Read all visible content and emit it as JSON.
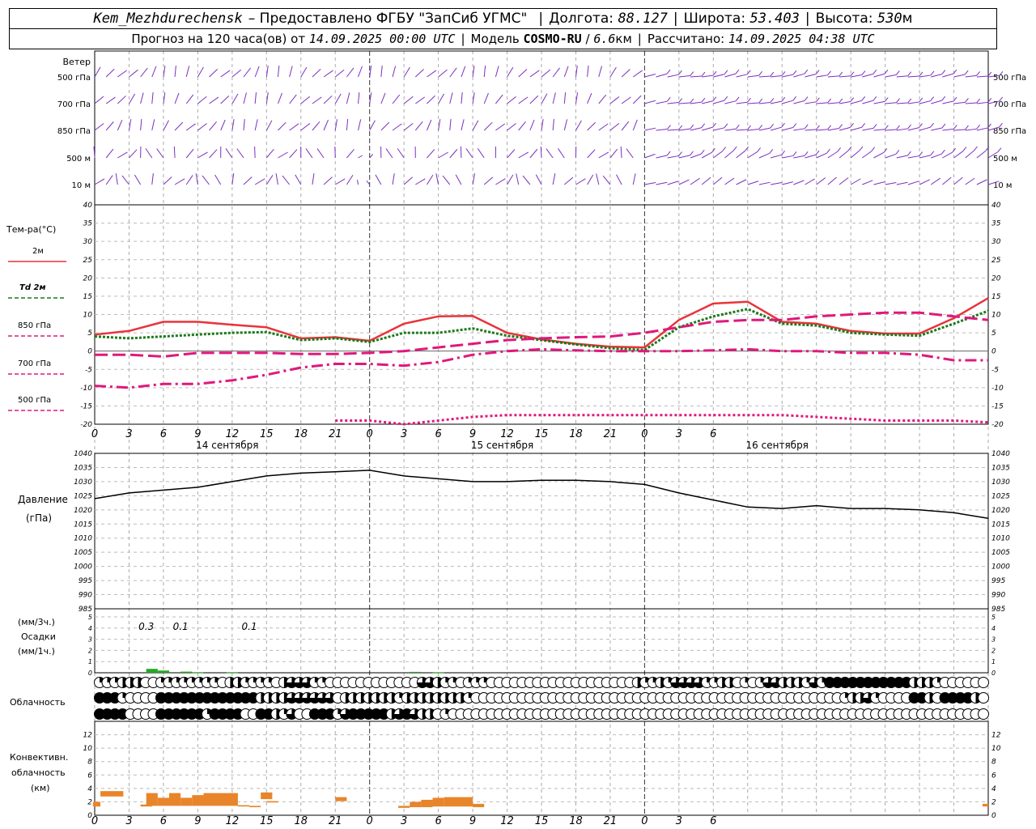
{
  "header": {
    "station": "Kem_Mezhdurechensk",
    "provided_by": "– Предоставлено ФГБУ \"ЗапСиб УГМС\"",
    "lon_label": "Долгота:",
    "lon_value": "88.127",
    "lat_label": "Широта:",
    "lat_value": "53.403",
    "alt_label": "Высота:",
    "alt_value": "530",
    "alt_unit": "м",
    "forecast_label": "Прогноз на 120 часа(ов)  от",
    "forecast_start": "14.09.2025 00:00 UTC",
    "model_label": "Модель",
    "model_name": "COSMO-RU",
    "model_res_value": "6.6",
    "model_res_unit": "км",
    "computed_label": "Рассчитано:",
    "computed_time": "14.09.2025 04:38 UTC"
  },
  "colors": {
    "t2m": "#e8343a",
    "td2m": "#1a7a1a",
    "t850": "#e0187c",
    "t700": "#e0187c",
    "t500": "#e0187c",
    "wind": "#7b2fbf",
    "pressure": "#000000",
    "precip": "#22aa22",
    "convective": "#e8852a",
    "grid": "#999999"
  },
  "chart_data": {
    "type": "line",
    "x_ticks": [
      "0",
      "3",
      "6",
      "9",
      "12",
      "15",
      "18",
      "21",
      "0",
      "3",
      "6",
      "9",
      "12",
      "15",
      "18",
      "21",
      "0",
      "3",
      "6"
    ],
    "day_labels": [
      {
        "label": "14 сентября"
      },
      {
        "label": "15 сентября"
      },
      {
        "label": "16 сентября"
      }
    ],
    "wind": {
      "label": "Ветер",
      "levels": [
        "500 гПа",
        "700 гПа",
        "850 гПа",
        "500 м",
        "10  м"
      ],
      "unit_left_prefix": "",
      "right_levels": [
        "500 гПа",
        "700 гПа",
        "850 гПа",
        "500 м",
        "10  м"
      ]
    },
    "temperature": {
      "ylabel": "Тем-ра(°С)",
      "ylim": [
        -20,
        40
      ],
      "y_ticks": [
        40,
        35,
        30,
        25,
        20,
        15,
        10,
        5,
        0,
        -5,
        -10,
        -15,
        -20
      ],
      "x_hours": [
        0,
        3,
        6,
        9,
        12,
        15,
        18,
        21,
        24,
        27,
        30,
        33,
        36,
        39,
        42,
        45,
        48,
        51,
        54,
        57,
        60,
        63,
        66,
        69,
        72,
        75,
        78
      ],
      "series": [
        {
          "name": "2м",
          "values": [
            4.5,
            5.5,
            8,
            8,
            7.2,
            6.5,
            3.5,
            3.8,
            2.8,
            7.5,
            9.5,
            9.6,
            5,
            3.2,
            2,
            1.2,
            1,
            8.5,
            13,
            13.5,
            8,
            7.5,
            5.5,
            4.8,
            4.8,
            9,
            14.5
          ]
        },
        {
          "name": "Td 2м",
          "values": [
            4,
            3.5,
            4,
            4.5,
            5,
            5.2,
            3,
            3.5,
            2.5,
            5,
            5,
            6.2,
            4.2,
            3,
            1.8,
            0.8,
            0.3,
            6.5,
            9.5,
            11.5,
            7.5,
            7,
            5,
            4.5,
            4.2,
            7.5,
            11
          ]
        },
        {
          "name": "850 гПа",
          "values": [
            -1,
            -1,
            -1.5,
            -0.5,
            -0.5,
            -0.5,
            -0.8,
            -0.8,
            -0.5,
            0,
            1,
            2,
            3,
            3.5,
            3.8,
            4,
            5,
            6.5,
            8,
            8.5,
            8.5,
            9.5,
            10,
            10.5,
            10.5,
            9.5,
            8.5
          ]
        },
        {
          "name": "700 гПа",
          "values": [
            -9.5,
            -10,
            -9,
            -9,
            -8,
            -6.5,
            -4.5,
            -3.5,
            -3.5,
            -4,
            -3,
            -1,
            0,
            0.5,
            0.2,
            0,
            0,
            0,
            0.2,
            0.5,
            0,
            0,
            -0.5,
            -0.5,
            -1,
            -2.5,
            -2.5
          ]
        },
        {
          "name": "500 гПа",
          "values": [
            null,
            null,
            null,
            null,
            null,
            null,
            null,
            -19,
            -19,
            -20,
            -19,
            -18,
            -17.5,
            -17.5,
            -17.5,
            -17.5,
            -17.5,
            -17.5,
            -17.5,
            -17.5,
            -17.5,
            -18,
            -18.5,
            -19,
            -19,
            -19,
            -19.5
          ]
        }
      ]
    },
    "pressure": {
      "ylabel": "Давление",
      "yunit": "(гПа)",
      "ylim": [
        985,
        1040
      ],
      "y_ticks": [
        1040,
        1035,
        1030,
        1025,
        1020,
        1015,
        1010,
        1005,
        1000,
        995,
        990,
        985
      ],
      "x_hours": [
        0,
        3,
        6,
        9,
        12,
        15,
        18,
        21,
        24,
        27,
        30,
        33,
        36,
        39,
        42,
        45,
        48,
        51,
        54,
        57,
        60,
        63,
        66,
        69,
        72,
        75,
        78
      ],
      "values": [
        1024,
        1026,
        1027,
        1028,
        1030,
        1032,
        1033,
        1033.5,
        1034,
        1032,
        1031,
        1030,
        1030,
        1030.5,
        1030.5,
        1030,
        1029,
        1026,
        1023.5,
        1021,
        1020.5,
        1021.5,
        1020.5,
        1020.5,
        1020,
        1019,
        1017
      ]
    },
    "precipitation": {
      "ylabel_top": "(мм/3ч.)",
      "ylabel_mid": "Осадки",
      "ylabel_bottom": "(мм/1ч.)",
      "ylim": [
        0,
        5
      ],
      "y_ticks": [
        5,
        4,
        3,
        2,
        1,
        0
      ],
      "amounts_3h": [
        {
          "hour": 4.5,
          "label": "0.3"
        },
        {
          "hour": 7.5,
          "label": "0.1"
        },
        {
          "hour": 13.5,
          "label": "0.1"
        }
      ],
      "hourly": [
        {
          "hour": 5,
          "value": 0.35
        },
        {
          "hour": 6,
          "value": 0.2
        },
        {
          "hour": 8,
          "value": 0.1
        },
        {
          "hour": 9,
          "value": 0.05
        },
        {
          "hour": 12,
          "value": 0.05
        },
        {
          "hour": 28,
          "value": 0.08
        },
        {
          "hour": 30,
          "value": 0.05
        }
      ]
    },
    "cloudiness": {
      "label": "Облачность",
      "rows": [
        "11122200111111110221111023331100000000000033211011100000000000000000002112133331122010133222131444444444442221000000",
        "44410000444444444444422223333330222222212222222210000000000000000000000000000000000000000000000001223100004420444420",
        "44440000444444144440044213004441344444234322010000000000000000000000000000000000000000000000000000000000000000000000"
      ]
    },
    "convective": {
      "ylabel1": "Конвективн.",
      "ylabel2": "облачность",
      "ylabel3": "(км)",
      "ylim": [
        0,
        14
      ],
      "y_ticks": [
        12,
        10,
        8,
        6,
        4,
        2,
        0
      ],
      "segments": [
        {
          "h0": -0.5,
          "h1": 0.5,
          "bottom": 1.3,
          "top": 2
        },
        {
          "h0": 0.5,
          "h1": 2.5,
          "bottom": 2.8,
          "top": 3.6
        },
        {
          "h0": 4,
          "h1": 5,
          "bottom": 1.3,
          "top": 1.6
        },
        {
          "h0": 4.5,
          "h1": 5.5,
          "bottom": 1.4,
          "top": 3.3
        },
        {
          "h0": 5.5,
          "h1": 6.5,
          "bottom": 1.4,
          "top": 2.6
        },
        {
          "h0": 6.5,
          "h1": 7.5,
          "bottom": 1.4,
          "top": 3.3
        },
        {
          "h0": 7.5,
          "h1": 8.5,
          "bottom": 1.4,
          "top": 2.6
        },
        {
          "h0": 8.5,
          "h1": 9.5,
          "bottom": 1.4,
          "top": 3
        },
        {
          "h0": 9.5,
          "h1": 12.5,
          "bottom": 1.4,
          "top": 3.3
        },
        {
          "h0": 12.5,
          "h1": 13.5,
          "bottom": 1.3,
          "top": 1.5
        },
        {
          "h0": 13.5,
          "h1": 14.5,
          "bottom": 1.2,
          "top": 1.4
        },
        {
          "h0": 14.5,
          "h1": 15.5,
          "bottom": 2.4,
          "top": 3.4
        },
        {
          "h0": 15,
          "h1": 16,
          "bottom": 1.9,
          "top": 2.1
        },
        {
          "h0": 21,
          "h1": 22,
          "bottom": 2.1,
          "top": 2.7
        },
        {
          "h0": 26.5,
          "h1": 27.5,
          "bottom": 1.1,
          "top": 1.4
        },
        {
          "h0": 27.5,
          "h1": 28.5,
          "bottom": 1.2,
          "top": 2
        },
        {
          "h0": 28.5,
          "h1": 29.5,
          "bottom": 1.2,
          "top": 2.3
        },
        {
          "h0": 29.5,
          "h1": 30.5,
          "bottom": 1.3,
          "top": 2.6
        },
        {
          "h0": 30.5,
          "h1": 33,
          "bottom": 1.3,
          "top": 2.7
        },
        {
          "h0": 33,
          "h1": 34,
          "bottom": 1.2,
          "top": 1.7
        },
        {
          "h0": 77.5,
          "h1": 78,
          "bottom": 1.3,
          "top": 1.7
        }
      ]
    }
  }
}
